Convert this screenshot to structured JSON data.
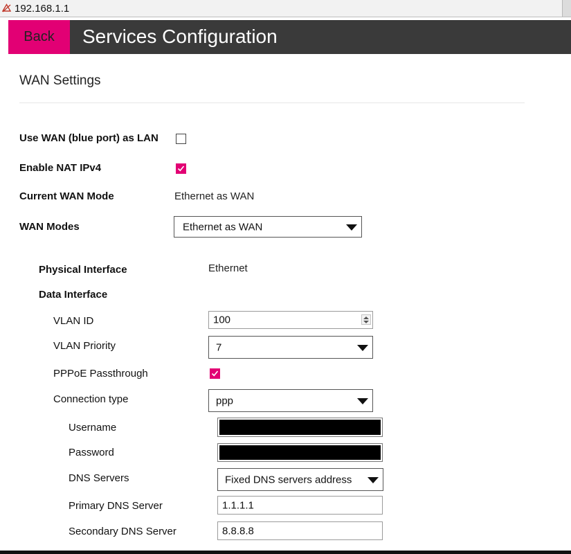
{
  "browser": {
    "address": "192.168.1.1"
  },
  "header": {
    "back_label": "Back",
    "title": "Services Configuration"
  },
  "section": {
    "title": "WAN Settings"
  },
  "settings": {
    "use_wan_as_lan": {
      "label": "Use WAN (blue port) as LAN",
      "checked": false
    },
    "enable_nat": {
      "label": "Enable NAT IPv4",
      "checked": true
    },
    "current_wan_mode": {
      "label": "Current WAN Mode",
      "value": "Ethernet as WAN"
    },
    "wan_modes": {
      "label": "WAN Modes",
      "selected": "Ethernet as WAN"
    }
  },
  "interface": {
    "physical_label": "Physical Interface",
    "physical_value": "Ethernet",
    "data_label": "Data Interface",
    "vlan_id": {
      "label": "VLAN ID",
      "value": "100"
    },
    "vlan_priority": {
      "label": "VLAN Priority",
      "selected": "7"
    },
    "pppoe_passthrough": {
      "label": "PPPoE Passthrough",
      "checked": true
    },
    "connection_type": {
      "label": "Connection type",
      "selected": "ppp"
    }
  },
  "ppp": {
    "username": {
      "label": "Username",
      "redacted": true
    },
    "password": {
      "label": "Password",
      "redacted": true
    },
    "dns_servers": {
      "label": "DNS Servers",
      "selected": "Fixed DNS servers address"
    },
    "primary_dns": {
      "label": "Primary DNS Server",
      "value": "1.1.1.1"
    },
    "secondary_dns": {
      "label": "Secondary DNS Server",
      "value": "8.8.8.8"
    }
  },
  "colors": {
    "accent": "#e20074",
    "header_bg": "#3a3a3a"
  },
  "icons": {
    "address_bar": "not-secure-icon",
    "dropdown": "caret-down-icon",
    "checkbox": "checkmark-icon",
    "spinner": "spinner-arrows-icon"
  }
}
